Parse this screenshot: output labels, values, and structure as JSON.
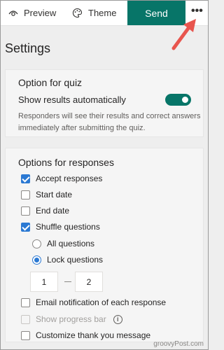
{
  "toolbar": {
    "preview_label": "Preview",
    "theme_label": "Theme",
    "send_label": "Send",
    "more_label": "•••"
  },
  "settings": {
    "title": "Settings"
  },
  "quiz_panel": {
    "title": "Option for quiz",
    "show_results_label": "Show results automatically",
    "show_results_on": true,
    "description": "Responders will see their results and correct answers immediately after submitting the quiz."
  },
  "responses_panel": {
    "title": "Options for responses",
    "options": [
      {
        "label": "Accept responses",
        "checked": true
      },
      {
        "label": "Start date",
        "checked": false
      },
      {
        "label": "End date",
        "checked": false
      },
      {
        "label": "Shuffle questions",
        "checked": true
      },
      {
        "label": "Email notification of each response",
        "checked": false
      },
      {
        "label": "Show progress bar",
        "checked": false,
        "disabled": true
      },
      {
        "label": "Customize thank you message",
        "checked": false
      }
    ],
    "shuffle_choices": [
      {
        "label": "All questions",
        "selected": false
      },
      {
        "label": "Lock questions",
        "selected": true
      }
    ],
    "lock_from": "1",
    "lock_to": "2",
    "info_glyph": "i"
  },
  "watermark": "groovyPost.com",
  "colors": {
    "accent": "#077568",
    "checkbox": "#2b79d3",
    "arrow": "#e8554e"
  }
}
